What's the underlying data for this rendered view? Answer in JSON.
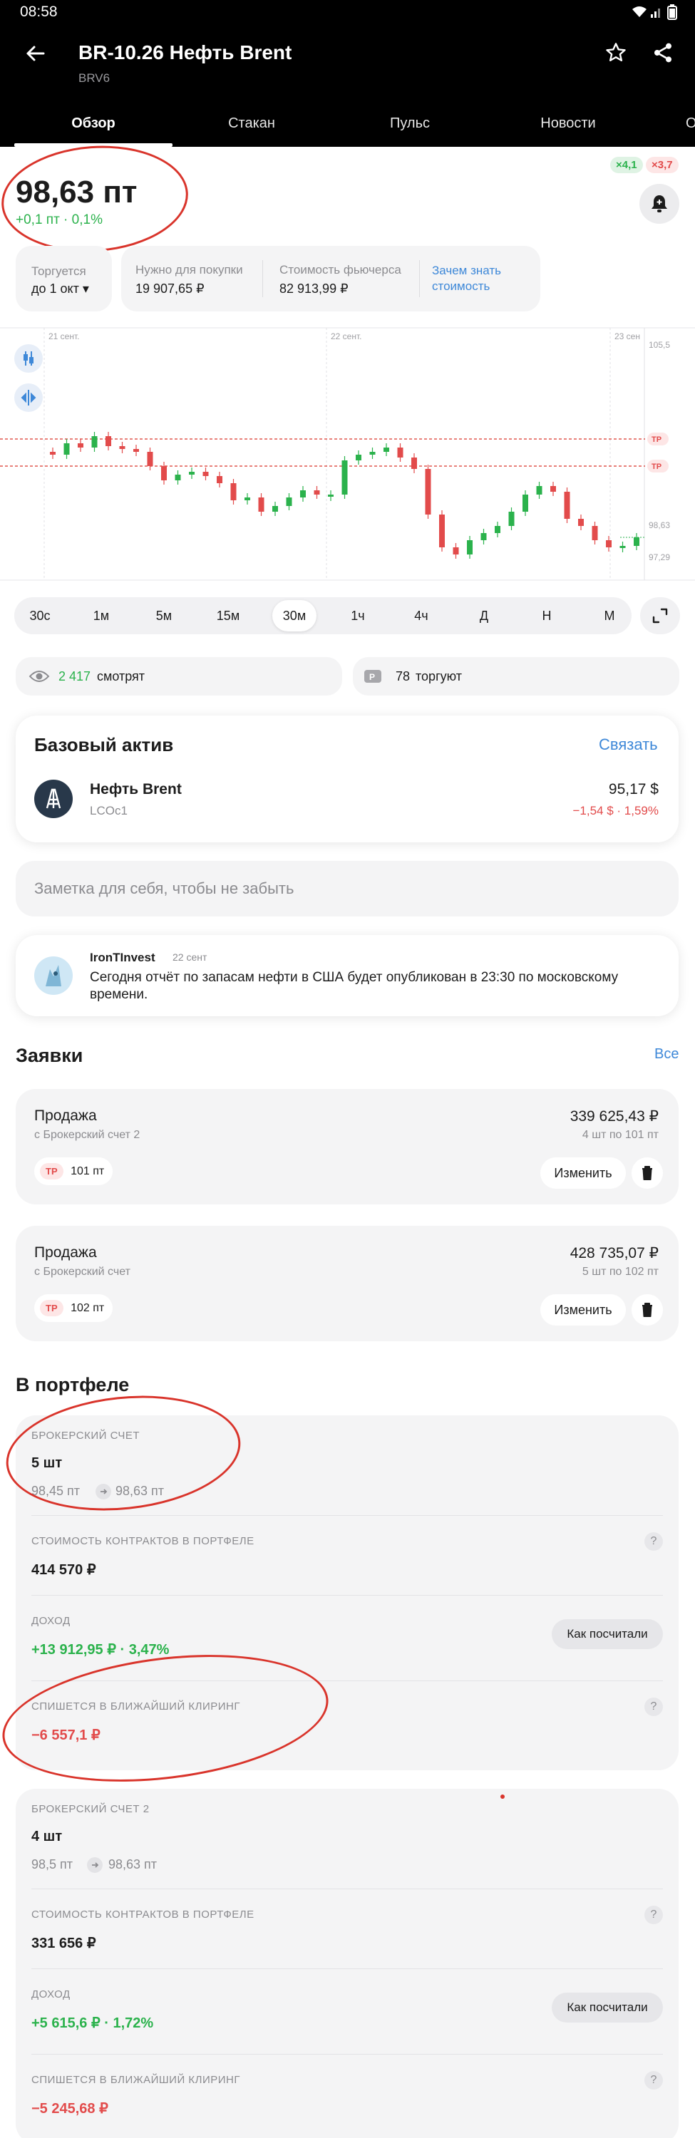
{
  "status_bar": {
    "time": "08:58"
  },
  "header": {
    "title": "BR-10.26 Нефть Brent",
    "subtitle": "BRV6",
    "back_icon": "arrow-left-icon",
    "star_icon": "star-icon",
    "share_icon": "share-icon"
  },
  "tabs": [
    {
      "label": "Обзор"
    },
    {
      "label": "Стакан"
    },
    {
      "label": "Пульс"
    },
    {
      "label": "Новости"
    },
    {
      "label": "О"
    }
  ],
  "price": {
    "value": "98,63 пт",
    "change": "+0,1 пт · 0,1%",
    "badge_green": "×4,1",
    "badge_red": "×3,7"
  },
  "info_cards": {
    "trade_label": "Торгуется",
    "trade_value": "до 1 окт ▾",
    "need_label": "Нужно для покупки",
    "need_value": "19 907,65 ₽",
    "cost_label": "Стоимость фьючерса",
    "cost_value": "82 913,99 ₽",
    "why_link": "Зачем знать стоимость"
  },
  "chart_data": {
    "type": "candlestick",
    "x_labels": [
      "21 сент.",
      "22 сент.",
      "23 сен"
    ],
    "y_labels": [
      "105,5",
      "98,63",
      "97,29"
    ],
    "annotations": [
      "TP",
      "TP"
    ],
    "candles": [
      [
        98.72,
        98.7
      ],
      [
        98.7,
        98.78
      ],
      [
        98.78,
        98.75
      ],
      [
        98.75,
        98.83
      ],
      [
        98.83,
        98.76
      ],
      [
        98.76,
        98.74
      ],
      [
        98.74,
        98.72
      ],
      [
        98.72,
        98.62
      ],
      [
        98.62,
        98.52
      ],
      [
        98.52,
        98.56
      ],
      [
        98.56,
        98.58
      ],
      [
        98.58,
        98.55
      ],
      [
        98.55,
        98.5
      ],
      [
        98.5,
        98.38
      ],
      [
        98.38,
        98.4
      ],
      [
        98.4,
        98.3
      ],
      [
        98.3,
        98.34
      ],
      [
        98.34,
        98.4
      ],
      [
        98.4,
        98.45
      ],
      [
        98.45,
        98.42
      ],
      [
        98.42,
        98.42
      ],
      [
        98.42,
        98.66
      ],
      [
        98.66,
        98.7
      ],
      [
        98.7,
        98.72
      ],
      [
        98.72,
        98.75
      ],
      [
        98.75,
        98.68
      ],
      [
        98.68,
        98.6
      ],
      [
        98.6,
        98.28
      ],
      [
        98.28,
        98.05
      ],
      [
        98.05,
        98.0
      ],
      [
        98.0,
        98.1
      ],
      [
        98.1,
        98.15
      ],
      [
        98.15,
        98.2
      ],
      [
        98.2,
        98.3
      ],
      [
        98.3,
        98.42
      ],
      [
        98.42,
        98.48
      ],
      [
        98.48,
        98.44
      ],
      [
        98.44,
        98.25
      ],
      [
        98.25,
        98.2
      ],
      [
        98.2,
        98.1
      ],
      [
        98.1,
        98.05
      ],
      [
        98.05,
        98.06
      ],
      [
        98.06,
        98.12
      ]
    ]
  },
  "timeframes": [
    "30с",
    "1м",
    "5м",
    "15м",
    "30м",
    "1ч",
    "4ч",
    "Д",
    "Н",
    "М"
  ],
  "timeframe_selected": "30м",
  "watchers": {
    "count": "2 417",
    "watch_text": "смотрят",
    "trading_count": "78",
    "trading_text": "торгуют"
  },
  "base_asset": {
    "title": "Базовый актив",
    "link": "Связать",
    "name": "Нефть Brent",
    "ticker": "LCOc1",
    "price": "95,17 $",
    "change": "−1,54 $ · 1,59%"
  },
  "note": {
    "placeholder": "Заметка для себя, чтобы не забыть"
  },
  "post": {
    "author": "IronTInvest",
    "date": "22 сент",
    "text": "Сегодня отчёт по запасам нефти в США будет опубликован в 23:30 по московскому времени."
  },
  "orders": {
    "title": "Заявки",
    "all_link": "Все",
    "items": [
      {
        "type": "Продажа",
        "account": "с Брокерский счет 2",
        "amount": "339 625,43 ₽",
        "detail": "4 шт по 101 пт",
        "tag": "TP",
        "tag_value": "101 пт",
        "edit": "Изменить"
      },
      {
        "type": "Продажа",
        "account": "с Брокерский счет",
        "amount": "428 735,07 ₽",
        "detail": "5 шт по 102 пт",
        "tag": "TP",
        "tag_value": "102 пт",
        "edit": "Изменить"
      }
    ]
  },
  "portfolio": {
    "title": "В портфеле",
    "accounts": [
      {
        "name": "БРОКЕРСКИЙ СЧЕТ",
        "qty": "5 шт",
        "price_from": "98,45 пт",
        "price_to": "98,63 пт",
        "cost_label": "СТОИМОСТЬ КОНТРАКТОВ В ПОРТФЕЛЕ",
        "cost_value": "414 570 ₽",
        "income_label": "ДОХОД",
        "income_value": "+13 912,95 ₽ · 3,47%",
        "income_button": "Как посчитали",
        "clearing_label": "СПИШЕТСЯ В БЛИЖАЙШИЙ КЛИРИНГ",
        "clearing_value": "−6 557,1 ₽"
      },
      {
        "name": "БРОКЕРСКИЙ СЧЕТ 2",
        "qty": "4 шт",
        "price_from": "98,5 пт",
        "price_to": "98,63 пт",
        "cost_label": "СТОИМОСТЬ КОНТРАКТОВ В ПОРТФЕЛЕ",
        "cost_value": "331 656 ₽",
        "income_label": "ДОХОД",
        "income_value": "+5 615,6 ₽ · 1,72%",
        "income_button": "Как посчитали",
        "clearing_label": "СПИШЕТСЯ В БЛИЖАЙШИЙ КЛИРИНГ",
        "clearing_value": "−5 245,68 ₽"
      }
    ]
  },
  "colors": {
    "up": "#2bb24c",
    "down": "#e24b4b",
    "accent": "#3e88d8",
    "annotation": "#d9342b"
  }
}
